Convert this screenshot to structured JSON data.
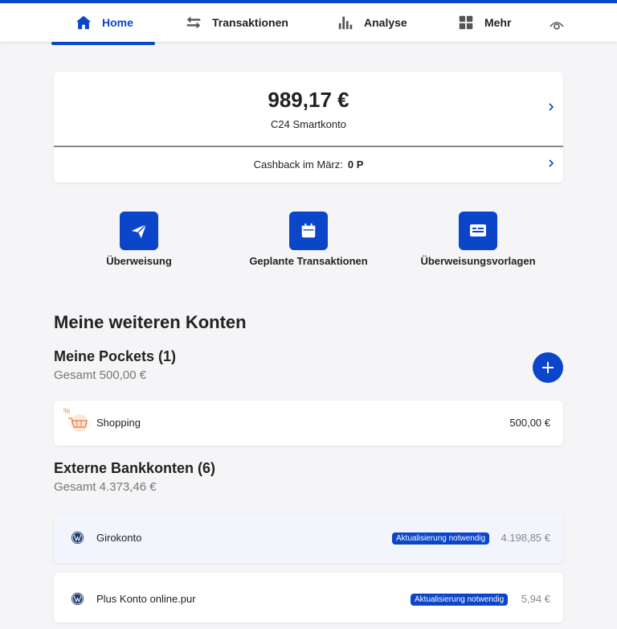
{
  "nav": {
    "items": [
      {
        "label": "Home",
        "icon": "home-icon"
      },
      {
        "label": "Transaktionen",
        "icon": "transfer-arrows-icon"
      },
      {
        "label": "Analyse",
        "icon": "bar-chart-icon"
      },
      {
        "label": "Mehr",
        "icon": "grid-icon"
      }
    ],
    "privacy_icon": "eye-icon",
    "accent": "#0b45c9"
  },
  "account": {
    "balance": "989,17 €",
    "name": "C24 Smartkonto",
    "cashback_label": "Cashback im März:",
    "cashback_value": "0 P"
  },
  "actions": [
    {
      "label": "Überweisung",
      "icon": "paper-plane-icon"
    },
    {
      "label": "Geplante Transaktionen",
      "icon": "calendar-icon"
    },
    {
      "label": "Überweisungsvorlagen",
      "icon": "card-template-icon"
    }
  ],
  "other_accounts": {
    "heading": "Meine weiteren Konten",
    "pockets": {
      "title": "Meine Pockets (1)",
      "total": "Gesamt 500,00 €",
      "items": [
        {
          "name": "Shopping",
          "amount": "500,00 €",
          "icon": "shopping-cart-icon"
        }
      ]
    },
    "external": {
      "title": "Externe Bankkonten (6)",
      "total": "Gesamt 4.373,46 €",
      "items": [
        {
          "name": "Girokonto",
          "badge": "Aktualisierung notwendig",
          "amount": "4.198,85 €",
          "icon": "vw-logo-icon"
        },
        {
          "name": "Plus Konto online.pur",
          "badge": "Aktualisierung notwendig",
          "amount": "5,94 €",
          "icon": "vw-logo-icon"
        }
      ]
    }
  }
}
